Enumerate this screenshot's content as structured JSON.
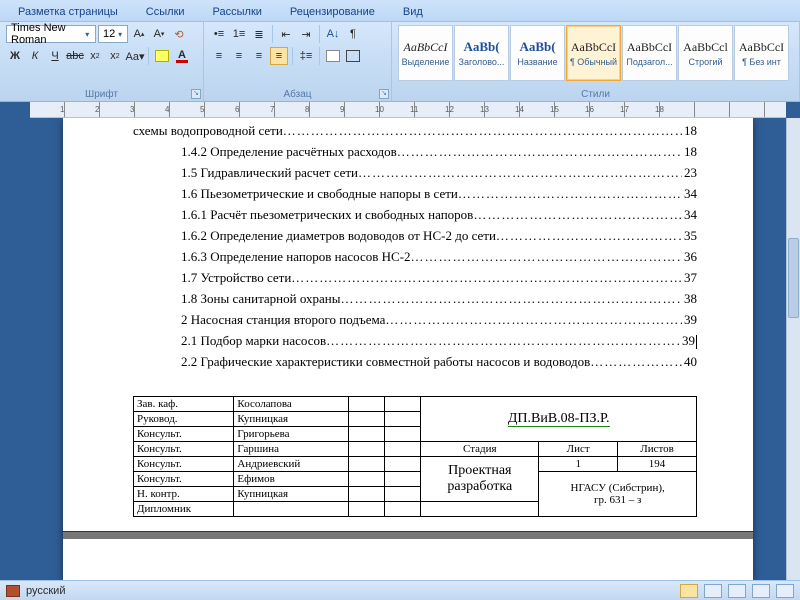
{
  "tabs": [
    "Разметка страницы",
    "Ссылки",
    "Рассылки",
    "Рецензирование",
    "Вид"
  ],
  "font": {
    "name": "Times New Roman",
    "size": "12"
  },
  "group_labels": {
    "font": "Шрифт",
    "para": "Абзац",
    "styles": "Стили"
  },
  "styles": [
    {
      "preview": "AaBbCcI",
      "name": "Выделение",
      "cls": "italic small"
    },
    {
      "preview": "AaBb(",
      "name": "Заголово...",
      "cls": "blue"
    },
    {
      "preview": "AaBb(",
      "name": "Название",
      "cls": "blue"
    },
    {
      "preview": "AaBbCcI",
      "name": "¶ Обычный",
      "cls": "small",
      "selected": true
    },
    {
      "preview": "AaBbCcI",
      "name": "Подзагол...",
      "cls": "small"
    },
    {
      "preview": "AaBbCcl",
      "name": "Строгий",
      "cls": "small"
    },
    {
      "preview": "AaBbCcI",
      "name": "¶ Без инт",
      "cls": "small"
    }
  ],
  "ruler_numbers": [
    1,
    2,
    3,
    4,
    5,
    6,
    7,
    8,
    9,
    10,
    11,
    12,
    13,
    14,
    15,
    16,
    17,
    18
  ],
  "toc": [
    {
      "indent": 0,
      "text": "схемы водопроводной сети",
      "page": "18"
    },
    {
      "indent": 1,
      "text": "1.4.2 Определение расчётных расходов",
      "page": "18"
    },
    {
      "indent": 1,
      "text": "1.5 Гидравлический расчет сети",
      "page": "23"
    },
    {
      "indent": 1,
      "text": "1.6 Пьезометрические и свободные напоры в сети",
      "page": "34"
    },
    {
      "indent": 1,
      "text": "1.6.1 Расчёт пьезометрических и свободных напоров",
      "page": "34"
    },
    {
      "indent": 1,
      "text": "1.6.2 Определение диаметров водоводов от НС-2 до сети",
      "page": "35"
    },
    {
      "indent": 1,
      "text": "1.6.3 Определение напоров насосов НС-2",
      "page": "36"
    },
    {
      "indent": 1,
      "text": "1.7 Устройство сети",
      "page": "37"
    },
    {
      "indent": 1,
      "text": "1.8 Зоны санитарной охраны",
      "page": "38"
    },
    {
      "indent": 1,
      "text": "2 Насосная станция второго подъема",
      "page": "39"
    },
    {
      "indent": 1,
      "text": "2.1 Подбор марки насосов",
      "page": "39",
      "caret": true
    },
    {
      "indent": 1,
      "text": "2.2 Графические характеристики совместной работы насосов и водоводов",
      "page": "40"
    }
  ],
  "stamp": {
    "rows": [
      {
        "role": "Зав. каф.",
        "name": "Косолапова"
      },
      {
        "role": "Руковод.",
        "name": "Купницкая"
      },
      {
        "role": "Консульт.",
        "name": "Григорьева"
      },
      {
        "role": "Консульт.",
        "name": "Гаршина"
      },
      {
        "role": "Консульт.",
        "name": "Андриевский"
      },
      {
        "role": "Консульт.",
        "name": "Ефимов"
      },
      {
        "role": "Н. контр.",
        "name": "Купницкая"
      },
      {
        "role": "Дипломник",
        "name": ""
      }
    ],
    "doc_code": "ДП.ВиВ.08-ПЗ.Р.",
    "title": "Проектная разработка",
    "col_headers": [
      "Стадия",
      "Лист",
      "Листов"
    ],
    "col_values": [
      "",
      "1",
      "194"
    ],
    "org": "НГАСУ (Сибстрин),",
    "group": "гр. 631 – з"
  },
  "status": {
    "lang": "русский"
  }
}
